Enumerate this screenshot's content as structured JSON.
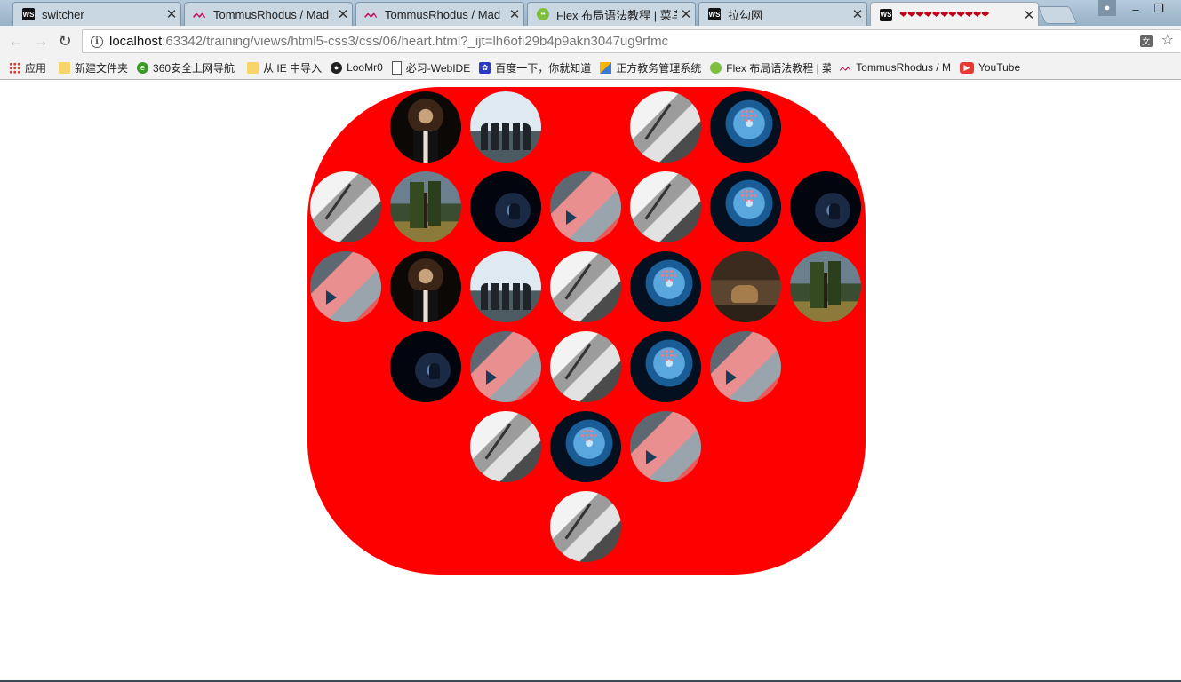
{
  "browser": {
    "tabs": [
      {
        "title": "switcher",
        "icon": "webstorm-icon",
        "active": false
      },
      {
        "title": "TommusRhodus / Mad",
        "icon": "tommusrhodus-icon",
        "active": false
      },
      {
        "title": "TommusRhodus / Mad",
        "icon": "tommusrhodus-icon",
        "active": false
      },
      {
        "title": "Flex 布局语法教程 | 菜鸟",
        "icon": "runoob-icon",
        "active": false
      },
      {
        "title": "拉勾网",
        "icon": "webstorm-icon",
        "active": false
      },
      {
        "title": "❤❤❤❤❤❤❤❤❤❤❤",
        "icon": "webstorm-icon",
        "active": true
      }
    ],
    "tab_close_glyph": "✕",
    "url": {
      "host": "localhost",
      "path": ":63342/training/views/html5-css3/css/06/heart.html?_ijt=lh6ofi29b4p9akn3047ug9rfmc"
    },
    "bookmarks": [
      {
        "label": "应用",
        "icon": "apps-icon"
      },
      {
        "label": "新建文件夹",
        "icon": "folder-icon"
      },
      {
        "label": "360安全上网导航",
        "icon": "360-icon"
      },
      {
        "label": "从 IE 中导入",
        "icon": "folder-icon"
      },
      {
        "label": "LooMr0",
        "icon": "github-icon"
      },
      {
        "label": "必习-WebIDE",
        "icon": "page-icon"
      },
      {
        "label": "百度一下，你就知道",
        "icon": "baidu-icon"
      },
      {
        "label": "正方教务管理系统",
        "icon": "zf-icon"
      },
      {
        "label": "Flex 布局语法教程 | 菜",
        "icon": "runoob-icon"
      },
      {
        "label": "TommusRhodus / M",
        "icon": "tommusrhodus-icon"
      },
      {
        "label": "YouTube",
        "icon": "youtube-icon"
      }
    ]
  },
  "page": {
    "background_color": "#ff0000",
    "photo_rows": [
      [
        "godfather",
        "friends",
        null,
        "writing",
        "brain"
      ],
      [
        "writing",
        "tree",
        "night",
        "illustration",
        "writing",
        "brain",
        "night"
      ],
      [
        "illustration",
        "godfather",
        "friends",
        "writing",
        "brain",
        "dogs",
        "tree"
      ],
      [
        "night",
        "illustration",
        "writing",
        "brain",
        "illustration"
      ],
      [
        "writing",
        "brain",
        "illustration"
      ],
      [
        "writing"
      ]
    ]
  }
}
